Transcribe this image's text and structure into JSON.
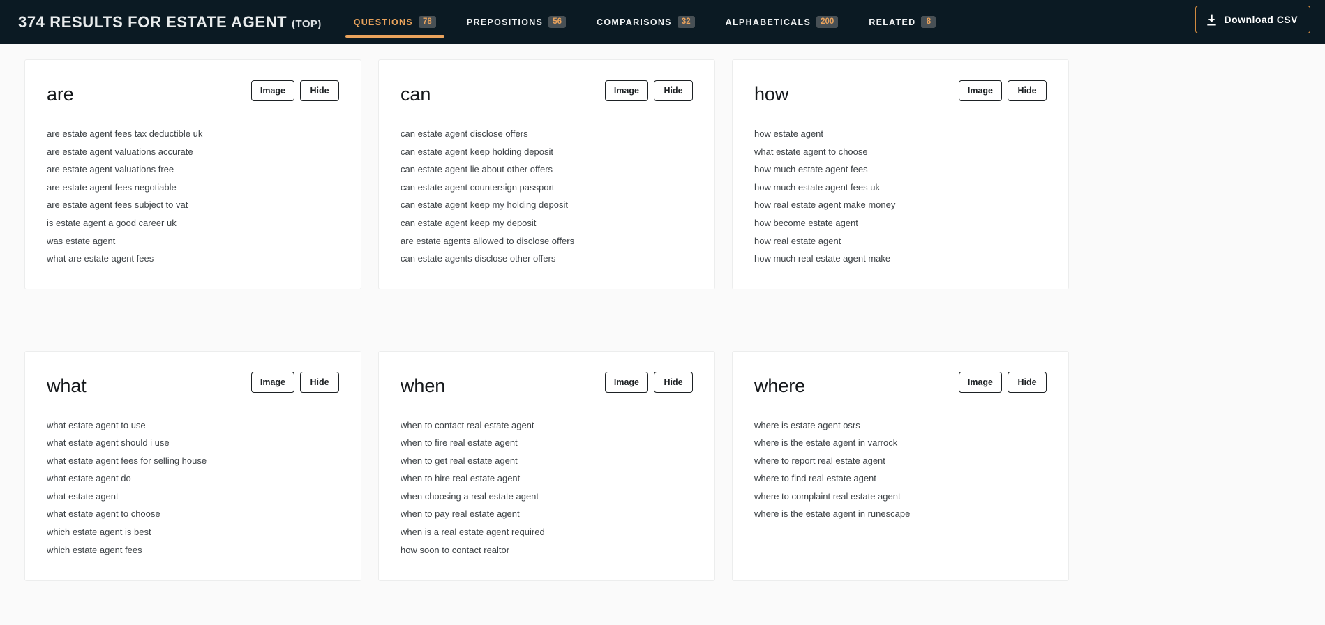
{
  "header": {
    "title_main": "374 results for estate agent",
    "title_sub": "(top)",
    "download_label": "Download CSV",
    "download_icon": "download-icon",
    "accent_color": "#eaa35d",
    "background_color": "#0b1a23",
    "tabs": [
      {
        "label": "Questions",
        "count": "78",
        "active": true
      },
      {
        "label": "Prepositions",
        "count": "56",
        "active": false
      },
      {
        "label": "Comparisons",
        "count": "32",
        "active": false
      },
      {
        "label": "Alphabeticals",
        "count": "200",
        "active": false
      },
      {
        "label": "Related",
        "count": "8",
        "active": false
      }
    ]
  },
  "buttons": {
    "image_label": "Image",
    "hide_label": "Hide"
  },
  "cards": [
    {
      "title": "are",
      "items": [
        "are estate agent fees tax deductible uk",
        "are estate agent valuations accurate",
        "are estate agent valuations free",
        "are estate agent fees negotiable",
        "are estate agent fees subject to vat",
        "is estate agent a good career uk",
        "was estate agent",
        "what are estate agent fees"
      ]
    },
    {
      "title": "can",
      "items": [
        "can estate agent disclose offers",
        "can estate agent keep holding deposit",
        "can estate agent lie about other offers",
        "can estate agent countersign passport",
        "can estate agent keep my holding deposit",
        "can estate agent keep my deposit",
        "are estate agents allowed to disclose offers",
        "can estate agents disclose other offers"
      ]
    },
    {
      "title": "how",
      "items": [
        "how estate agent",
        "what estate agent to choose",
        "how much estate agent fees",
        "how much estate agent fees uk",
        "how real estate agent make money",
        "how become estate agent",
        "how real estate agent",
        "how much real estate agent make"
      ]
    },
    {
      "title": "what",
      "items": [
        "what estate agent to use",
        "what estate agent should i use",
        "what estate agent fees for selling house",
        "what estate agent do",
        "what estate agent",
        "what estate agent to choose",
        "which estate agent is best",
        "which estate agent fees"
      ]
    },
    {
      "title": "when",
      "items": [
        "when to contact real estate agent",
        "when to fire real estate agent",
        "when to get real estate agent",
        "when to hire real estate agent",
        "when choosing a real estate agent",
        "when to pay real estate agent",
        "when is a real estate agent required",
        "how soon to contact realtor"
      ]
    },
    {
      "title": "where",
      "items": [
        "where is estate agent osrs",
        "where is the estate agent in varrock",
        "where to report real estate agent",
        "where to find real estate agent",
        "where to complaint real estate agent",
        "where is the estate agent in runescape"
      ]
    }
  ]
}
